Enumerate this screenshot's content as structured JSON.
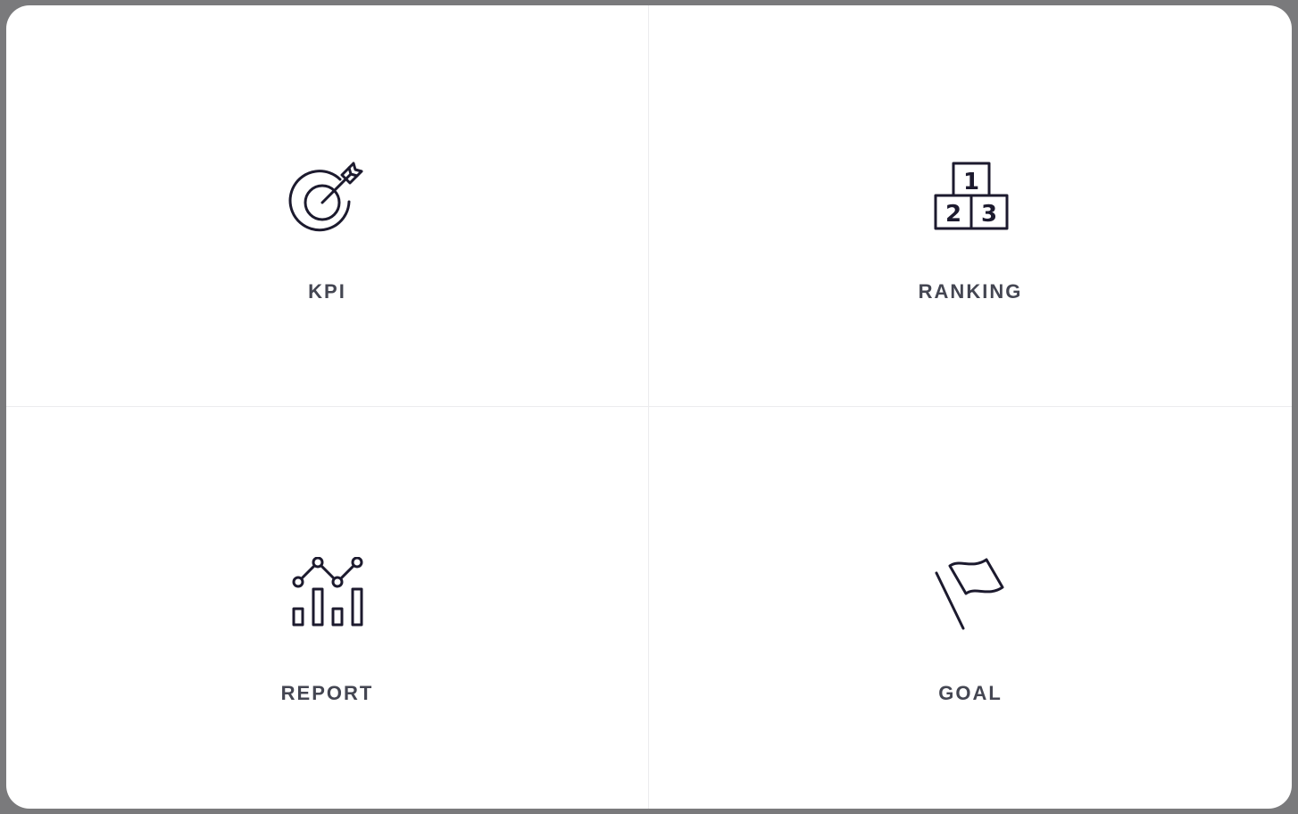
{
  "tiles": [
    {
      "id": "kpi",
      "label": "KPI",
      "icon": "target-arrow-icon"
    },
    {
      "id": "ranking",
      "label": "RANKING",
      "icon": "podium-icon",
      "podium": {
        "first": "1",
        "second": "2",
        "third": "3"
      }
    },
    {
      "id": "report",
      "label": "REPORT",
      "icon": "line-bar-chart-icon"
    },
    {
      "id": "goal",
      "label": "GOAL",
      "icon": "flag-icon"
    }
  ],
  "colors": {
    "icon_stroke": "#1c1a2e",
    "label_text": "#444652",
    "modal_background": "#ffffff",
    "divider": "#ececee",
    "backdrop": "#7a7a7c"
  }
}
